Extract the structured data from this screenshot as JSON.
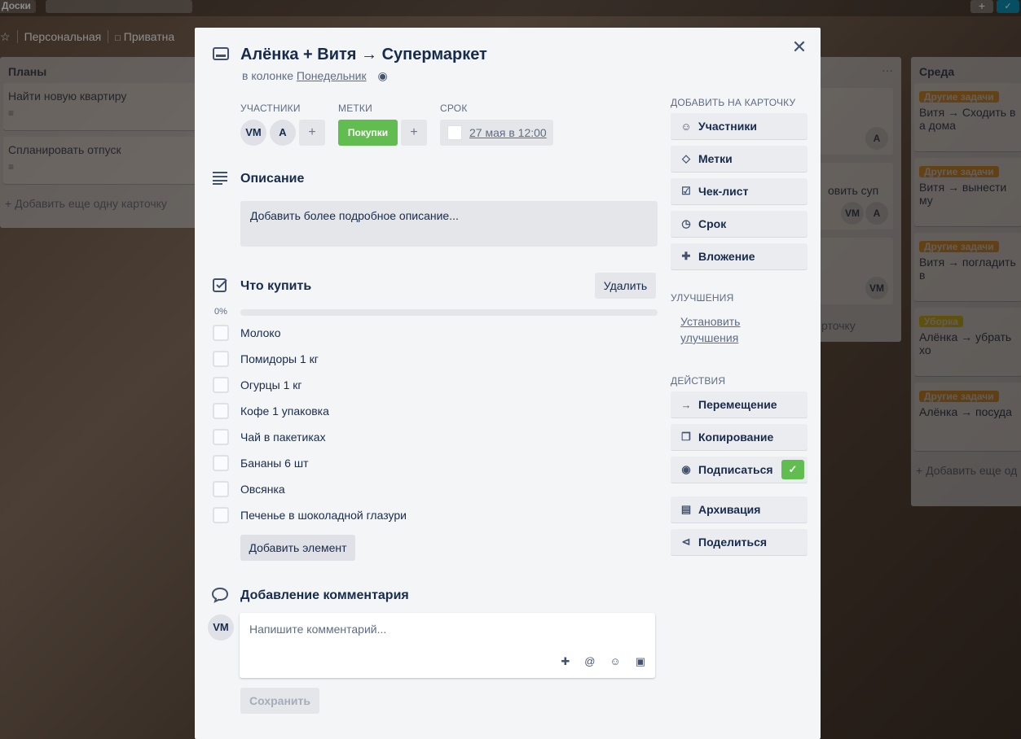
{
  "background": {
    "topbar": {
      "boards_label": "Доски",
      "plus_label": "+",
      "bell_label": "✓"
    },
    "boardbar": {
      "star": "☆",
      "team": "Персональная",
      "lock": "🔒",
      "visibility": "Приватна"
    },
    "lists": {
      "plans": {
        "title": "Планы",
        "cards": [
          "Найти новую квартиру",
          "Спланировать отпуск"
        ],
        "add_card": "+ Добавить еще одну карточку"
      },
      "middle": {
        "card_text": "овить суп",
        "avatar_a": "A",
        "avatar_vm": "VM",
        "avatar_a2": "A",
        "avatar_vm2": "VM",
        "add_card": "рточку",
        "menu": "···"
      },
      "wednesday": {
        "title": "Среда",
        "cards": [
          {
            "label": "Другие задачи",
            "label_color": "#ff9f1a",
            "text": "Витя → Сходить в а дома"
          },
          {
            "label": "Другие задачи",
            "label_color": "#ff9f1a",
            "text": "Витя → вынести му"
          },
          {
            "label": "Другие задачи",
            "label_color": "#ff9f1a",
            "text": "Витя → погладить в"
          },
          {
            "label": "Уборка",
            "label_color": "#f2d600",
            "text": "Алёнка → убрать хо"
          },
          {
            "label": "Другие задачи",
            "label_color": "#ff9f1a",
            "text": "Алёнка → посуда"
          }
        ],
        "add_card": "+ Добавить еще од"
      }
    }
  },
  "card": {
    "title": "Алёнка + Витя → Супермаркет",
    "in_list_prefix": "в колонке",
    "list_name": "Понедельник",
    "close_icon": "✕",
    "members_label": "УЧАСТНИКИ",
    "members": [
      "VM",
      "A"
    ],
    "labels_label": "МЕТКИ",
    "label_name": "Покупки",
    "label_color": "#61bd4f",
    "due_label": "СРОК",
    "due_value": "27 мая в 12:00",
    "add_symbol": "+",
    "description": {
      "title": "Описание",
      "placeholder": "Добавить более подробное описание..."
    },
    "checklist": {
      "title": "Что купить",
      "delete_label": "Удалить",
      "progress_text": "0%",
      "progress": 0,
      "items": [
        "Молоко",
        "Помидоры 1 кг",
        "Огурцы 1 кг",
        "Кофе 1 упаковка",
        "Чай в пакетиках",
        "Бананы 6 шт",
        "Овсянка",
        "Печенье в шоколадной глазури"
      ],
      "add_item_label": "Добавить элемент"
    },
    "comment": {
      "title": "Добавление комментария",
      "avatar": "VM",
      "placeholder": "Напишите комментарий...",
      "save_label": "Сохранить"
    }
  },
  "sidebar": {
    "add_to_card_label": "ДОБАВИТЬ НА КАРТОЧКУ",
    "add_buttons": [
      "Участники",
      "Метки",
      "Чек-лист",
      "Срок",
      "Вложение"
    ],
    "powerups_label": "УЛУЧШЕНИЯ",
    "powerups_link_1": "Установить",
    "powerups_link_2": "улучшения",
    "actions_label": "ДЕЙСТВИЯ",
    "action_buttons": [
      "Перемещение",
      "Копирование",
      "Подписаться",
      "Архивация",
      "Поделиться"
    ]
  }
}
